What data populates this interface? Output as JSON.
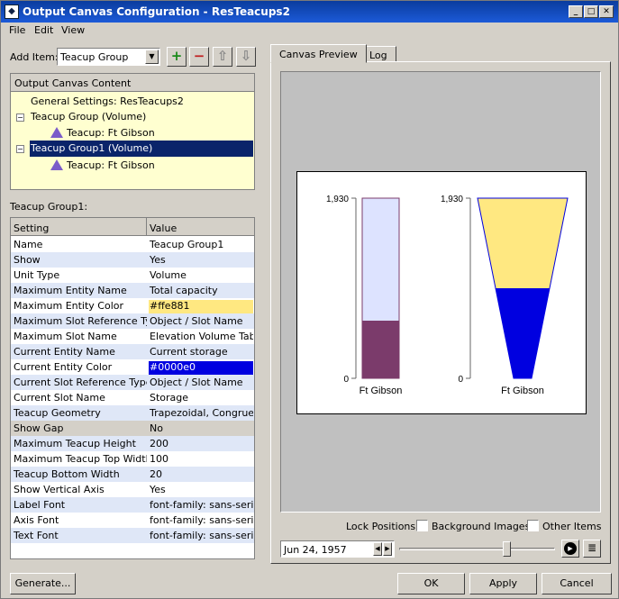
{
  "window": {
    "title": "Output Canvas Configuration - ResTeacups2",
    "app_icon": "app-icon"
  },
  "menu": [
    "File",
    "Edit",
    "View"
  ],
  "toolbar": {
    "add_item_label": "Add Item:",
    "add_item_value": "Teacup Group",
    "buttons": [
      "add-icon",
      "remove-icon",
      "move-up-icon",
      "move-down-icon"
    ]
  },
  "tree": {
    "header": "Output Canvas Content",
    "items": [
      {
        "label": "General Settings: ResTeacups2",
        "level": 0
      },
      {
        "label": "Teacup Group (Volume)",
        "level": 0,
        "expanded": true
      },
      {
        "label": "Teacup: Ft Gibson",
        "level": 1
      },
      {
        "label": "Teacup Group1 (Volume)",
        "level": 0,
        "expanded": true,
        "selected": true
      },
      {
        "label": "Teacup: Ft Gibson",
        "level": 1
      }
    ]
  },
  "section_title": "Teacup Group1:",
  "properties": {
    "header_setting": "Setting",
    "header_value": "Value",
    "rows": [
      {
        "setting": "Name",
        "value": "Teacup Group1"
      },
      {
        "setting": "Show",
        "value": "Yes"
      },
      {
        "setting": "Unit Type",
        "value": "Volume"
      },
      {
        "setting": "Maximum Entity Name",
        "value": "Total capacity"
      },
      {
        "setting": "Maximum Entity Color",
        "value": "#ffe881",
        "swatch": "#ffe881"
      },
      {
        "setting": "Maximum Slot Reference Type",
        "value": "Object / Slot Name"
      },
      {
        "setting": "Maximum Slot Name",
        "value": "Elevation Volume Table"
      },
      {
        "setting": "Current Entity Name",
        "value": "Current storage"
      },
      {
        "setting": "Current Entity Color",
        "value": "#0000e0",
        "swatch": "#0000e0"
      },
      {
        "setting": "Current Slot Reference Type",
        "value": "Object / Slot Name"
      },
      {
        "setting": "Current Slot Name",
        "value": "Storage"
      },
      {
        "setting": "Teacup Geometry",
        "value": "Trapezoidal, Congruent"
      },
      {
        "setting": "Show Gap",
        "value": "No",
        "disabled": true
      },
      {
        "setting": "Maximum Teacup Height",
        "value": "200"
      },
      {
        "setting": "Maximum Teacup Top Width",
        "value": "100"
      },
      {
        "setting": "Teacup Bottom Width",
        "value": "20"
      },
      {
        "setting": "Show Vertical Axis",
        "value": "Yes"
      },
      {
        "setting": "Label Font",
        "value": "font-family: sans-serif;"
      },
      {
        "setting": "Axis Font",
        "value": "font-family: sans-serif;"
      },
      {
        "setting": "Text Font",
        "value": "font-family: sans-serif;"
      }
    ]
  },
  "tabs": [
    {
      "label": "Canvas Preview",
      "active": true
    },
    {
      "label": "Log",
      "active": false
    }
  ],
  "preview": {
    "teacups": [
      {
        "label": "Ft Gibson",
        "shape": "rectangle",
        "max": 1930,
        "current_fraction": 0.32,
        "axis_ticks": [
          "1,930",
          "0"
        ],
        "max_color": "#dde3ff",
        "current_color": "#7b3b6b"
      },
      {
        "label": "Ft Gibson",
        "shape": "trapezoid",
        "max": 1930,
        "current_fraction": 0.5,
        "axis_ticks": [
          "1,930",
          "0"
        ],
        "max_color": "#ffe881",
        "current_color": "#0000e0"
      }
    ]
  },
  "lock_positions": {
    "label": "Lock Positions:",
    "options": [
      {
        "label": "Background Images",
        "checked": false
      },
      {
        "label": "Other Items",
        "checked": false
      }
    ]
  },
  "playback": {
    "date": "Jun 24, 1957",
    "slider_fraction": 0.7
  },
  "buttons": {
    "generate": "Generate...",
    "ok": "OK",
    "apply": "Apply",
    "cancel": "Cancel"
  }
}
